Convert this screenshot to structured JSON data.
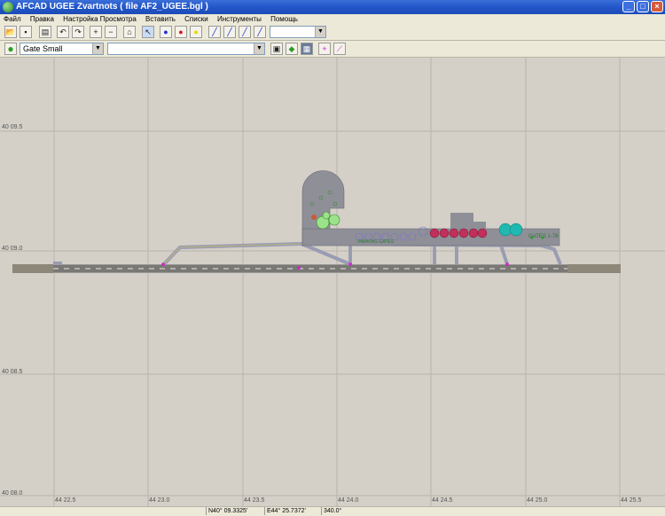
{
  "window": {
    "title": "AFCAD   UGEE   Zvartnots    ( file AF2_UGEE.bgl )"
  },
  "menu": [
    "Файл",
    "Правка",
    "Настройка Просмотра",
    "Вставить",
    "Списки",
    "Инструменты",
    "Помощь"
  ],
  "toolbar2": {
    "parking_type": "Gate Small",
    "second_combo": ""
  },
  "map": {
    "lat_labels": [
      "40 09.5",
      "40 09.0",
      "40 08.5",
      "40 08.0"
    ],
    "lon_labels": [
      "44 22.5",
      "44 23.0",
      "44 23.5",
      "44 24.0",
      "44 24.5",
      "44 25.0",
      "44 25.5"
    ],
    "apron_text": "PARKING GATES",
    "apron_text_right": "GATES 1-76"
  },
  "status": {
    "lat": "N40° 09.3325'",
    "lon": "E44° 25.7372'",
    "heading": "340.0°"
  }
}
